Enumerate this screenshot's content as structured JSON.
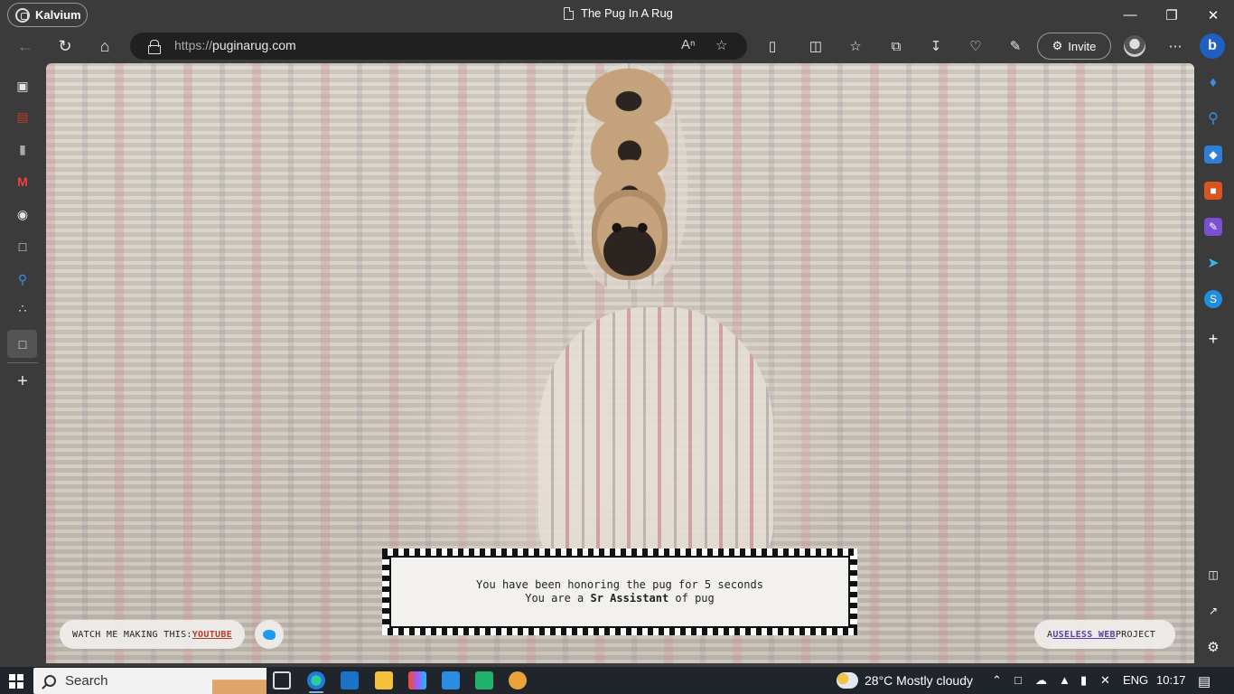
{
  "browser": {
    "profile_label": "Kalvium",
    "tab_title": "The Pug In A Rug",
    "url_protocol": "https://",
    "url_host": "puginarug.com",
    "invite_label": "Invite",
    "window_controls": [
      "minimize-icon",
      "restore-icon",
      "close-icon"
    ],
    "toolbar_icons": [
      "extensions-icon",
      "split-screen-icon",
      "favorites-icon",
      "collections-icon",
      "downloads-icon",
      "performance-icon",
      "drop-icon",
      "more-icon"
    ]
  },
  "left_sidebar": {
    "items": [
      "tab-actions-icon",
      "kalvium-icon",
      "app-icon",
      "gmail-icon",
      "github-icon",
      "document-icon",
      "search-app-icon",
      "dots-app-icon",
      "page-icon",
      "add-icon"
    ]
  },
  "right_sidebar": {
    "items": [
      "notifications-icon",
      "search-icon",
      "shopping-icon",
      "tools-icon",
      "designer-icon",
      "telegram-icon",
      "skype-icon",
      "add-icon",
      "split-icon",
      "open-external-icon",
      "settings-icon"
    ]
  },
  "page": {
    "message_line1_prefix": "You have been honoring the pug for ",
    "seconds": "5",
    "message_line1_suffix": " seconds",
    "message_line2_prefix": "You are a ",
    "rank": "Sr Assistant",
    "message_line2_suffix": " of pug",
    "watch_label": "WATCH ME MAKING THIS: ",
    "youtube_link": "YOUTUBE",
    "project_prefix": "A ",
    "useless_web_link": "USELESS WEB",
    "project_suffix": " PROJECT"
  },
  "taskbar": {
    "search_placeholder": "Search",
    "weather": "28°C  Mostly cloudy",
    "language": "ENG",
    "time": "10:17"
  }
}
